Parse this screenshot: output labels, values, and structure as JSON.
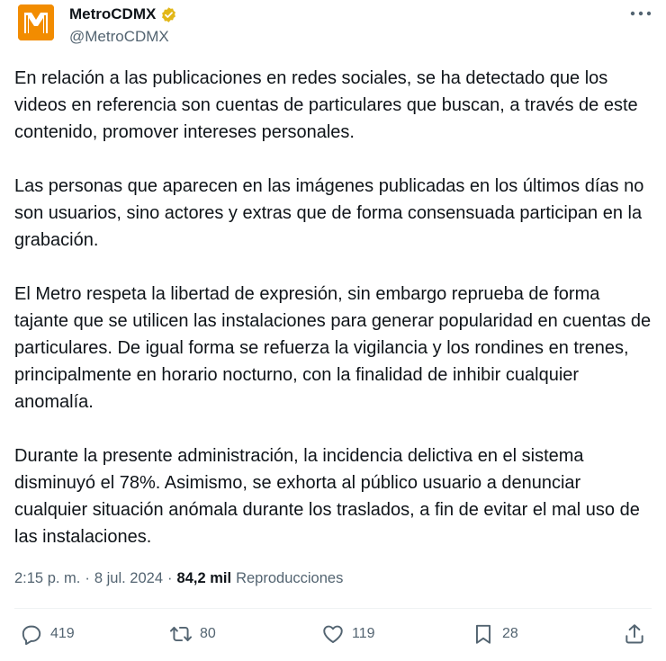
{
  "account": {
    "name": "MetroCDMX",
    "handle": "@MetroCDMX",
    "verified": true,
    "avatar_color": "#f28c00",
    "badge_color": "#e2b719"
  },
  "tweet": {
    "paragraphs": [
      "En relación a las publicaciones en redes sociales, se ha detectado que los videos en referencia son cuentas de particulares que buscan, a través de este contenido, promover intereses personales.",
      "Las personas que aparecen en las imágenes publicadas en los últimos días no son usuarios, sino actores y extras que de forma consensuada participan en la grabación.",
      "El Metro respeta la libertad de expresión, sin embargo reprueba de forma tajante que se utilicen las instalaciones para generar popularidad en cuentas de particulares. De igual forma se refuerza la vigilancia y los rondines en trenes, principalmente en horario nocturno, con la finalidad de inhibir cualquier anomalía.",
      "Durante la presente administración, la incidencia delictiva en el sistema disminuyó el 78%. Asimismo, se exhorta al público usuario a denunciar cualquier situación anómala durante los traslados, a fin de evitar el mal uso de las instalaciones."
    ],
    "time": "2:15 p. m.",
    "separator": "·",
    "date": "8 jul. 2024",
    "views_count": "84,2 mil",
    "views_label": "Reproducciones"
  },
  "actions": {
    "replies": "419",
    "retweets": "80",
    "likes": "119",
    "bookmarks": "28"
  },
  "icons": [
    "metro-logo-icon",
    "verified-badge-icon",
    "more-options-icon",
    "reply-icon",
    "retweet-icon",
    "like-icon",
    "bookmark-icon",
    "share-icon"
  ]
}
